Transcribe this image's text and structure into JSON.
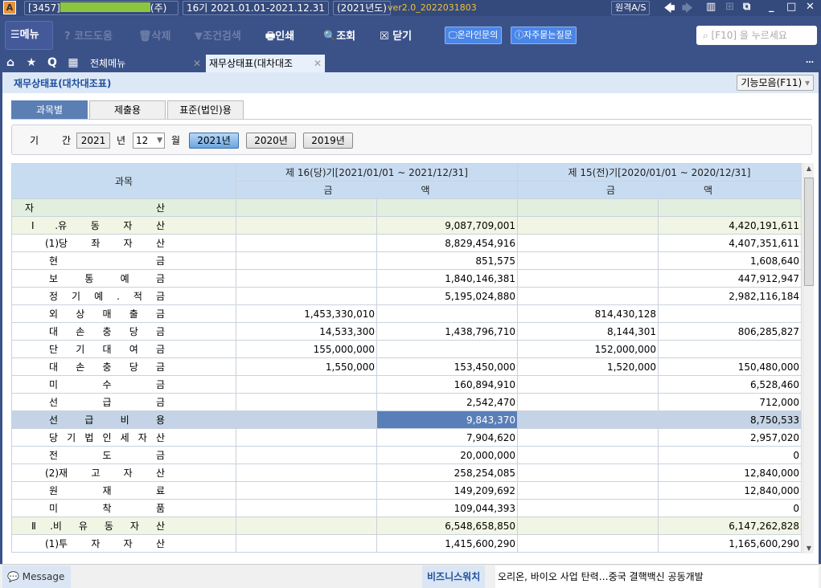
{
  "titlebar": {
    "logo": "A",
    "company_code": "[3457]",
    "company_suffix": "(주)",
    "period": "16기 2021.01.01-2021.12.31",
    "fiscal_year": "(2021년도)",
    "version": "ver2.0_2022031803",
    "remote_as": "원격A/S"
  },
  "toolbar": {
    "menu": "메뉴",
    "code_help": "코드도움",
    "delete": "삭제",
    "filter": "조건검색",
    "print": "인쇄",
    "search": "조회",
    "close": "닫기",
    "online_inquiry": "온라인문의",
    "faq": "자주묻는질문",
    "search_placeholder": "[F10] 을 누르세요"
  },
  "tabs": {
    "all_menu": "전체메뉴",
    "current": "재무상태표(대차대조"
  },
  "page": {
    "title": "재무상태표(대차대조표)",
    "functions": "기능모음(F11)"
  },
  "subtabs": [
    "과목별",
    "제출용",
    "표준(법인)용"
  ],
  "period": {
    "label1": "기",
    "label2": "간",
    "year": "2021",
    "year_unit": "년",
    "month": "12",
    "month_unit": "월",
    "buttons": [
      "2021년",
      "2020년",
      "2019년"
    ]
  },
  "table": {
    "col_account": "과목",
    "current_period": "제 16(당)기[2021/01/01 ~ 2021/12/31]",
    "prior_period": "제 15(전)기[2020/01/01 ~ 2020/12/31]",
    "amount_a": "금",
    "amount_b": "액",
    "rows": [
      {
        "label": "자 산",
        "level": 0,
        "style": "g",
        "c1": "",
        "c2": "",
        "p1": "",
        "p2": ""
      },
      {
        "label": "Ⅰ.유 동 자 산",
        "level": 1,
        "style": "y",
        "c1": "",
        "c2": "9,087,709,001",
        "p1": "",
        "p2": "4,420,191,611"
      },
      {
        "label": "(1)당 좌 자 산",
        "level": 2,
        "style": "",
        "c1": "",
        "c2": "8,829,454,916",
        "p1": "",
        "p2": "4,407,351,611"
      },
      {
        "label": "현 금",
        "level": 3,
        "style": "",
        "c1": "",
        "c2": "851,575",
        "p1": "",
        "p2": "1,608,640"
      },
      {
        "label": "보 통 예 금",
        "level": 3,
        "style": "",
        "c1": "",
        "c2": "1,840,146,381",
        "p1": "",
        "p2": "447,912,947"
      },
      {
        "label": "정 기 예 . 적 금",
        "level": 3,
        "style": "",
        "c1": "",
        "c2": "5,195,024,880",
        "p1": "",
        "p2": "2,982,116,184"
      },
      {
        "label": "외 상 매 출 금",
        "level": 3,
        "style": "",
        "c1": "1,453,330,010",
        "c2": "",
        "p1": "814,430,128",
        "p2": ""
      },
      {
        "label": "대 손 충 당 금",
        "level": 3,
        "style": "",
        "c1": "14,533,300",
        "c2": "1,438,796,710",
        "p1": "8,144,301",
        "p2": "806,285,827"
      },
      {
        "label": "단 기 대 여 금",
        "level": 3,
        "style": "",
        "c1": "155,000,000",
        "c2": "",
        "p1": "152,000,000",
        "p2": ""
      },
      {
        "label": "대 손 충 당 금",
        "level": 3,
        "style": "",
        "c1": "1,550,000",
        "c2": "153,450,000",
        "p1": "1,520,000",
        "p2": "150,480,000"
      },
      {
        "label": "미 수 금",
        "level": 3,
        "style": "",
        "c1": "",
        "c2": "160,894,910",
        "p1": "",
        "p2": "6,528,460"
      },
      {
        "label": "선 급 금",
        "level": 3,
        "style": "",
        "c1": "",
        "c2": "2,542,470",
        "p1": "",
        "p2": "712,000"
      },
      {
        "label": "선 급 비 용",
        "level": 3,
        "style": "sel",
        "c1": "",
        "c2": "9,843,370",
        "p1": "",
        "p2": "8,750,533"
      },
      {
        "label": "당 기 법 인 세 자 산",
        "level": 3,
        "style": "",
        "c1": "",
        "c2": "7,904,620",
        "p1": "",
        "p2": "2,957,020"
      },
      {
        "label": "전 도 금",
        "level": 3,
        "style": "",
        "c1": "",
        "c2": "20,000,000",
        "p1": "",
        "p2": "0"
      },
      {
        "label": "(2)재 고 자 산",
        "level": 2,
        "style": "",
        "c1": "",
        "c2": "258,254,085",
        "p1": "",
        "p2": "12,840,000"
      },
      {
        "label": "원 재 료",
        "level": 3,
        "style": "",
        "c1": "",
        "c2": "149,209,692",
        "p1": "",
        "p2": "12,840,000"
      },
      {
        "label": "미 착 품",
        "level": 3,
        "style": "",
        "c1": "",
        "c2": "109,044,393",
        "p1": "",
        "p2": "0"
      },
      {
        "label": "Ⅱ.비 유 동 자 산",
        "level": 1,
        "style": "y",
        "c1": "",
        "c2": "6,548,658,850",
        "p1": "",
        "p2": "6,147,262,828"
      },
      {
        "label": "(1)투 자 자 산",
        "level": 2,
        "style": "",
        "c1": "",
        "c2": "1,415,600,290",
        "p1": "",
        "p2": "1,165,600,290"
      }
    ]
  },
  "statusbar": {
    "message": "Message",
    "business_watch": "비즈니스워치",
    "news": "오리온, 바이오 사업 탄력…중국 결핵백신 공동개발"
  }
}
